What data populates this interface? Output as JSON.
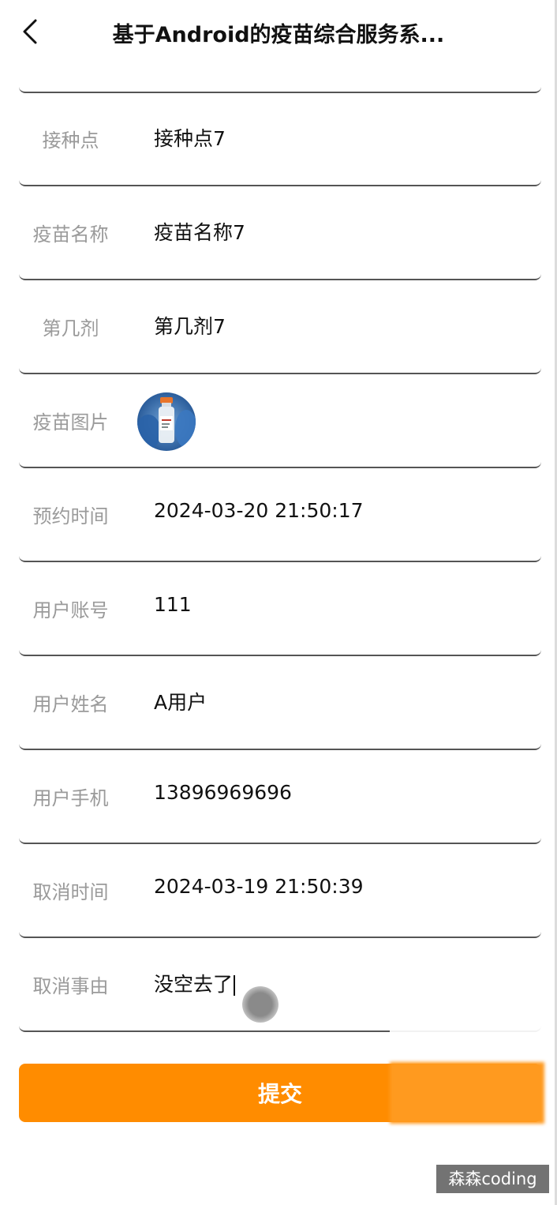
{
  "header": {
    "title": "基于Android的疫苗综合服务系...",
    "back_icon": "chevron-left-icon"
  },
  "form": {
    "rows": [
      {
        "label": "接种点",
        "value": "接种点7"
      },
      {
        "label": "疫苗名称",
        "value": "疫苗名称7"
      },
      {
        "label": "第几剂",
        "value": "第几剂7"
      },
      {
        "label": "疫苗图片",
        "value": ""
      },
      {
        "label": "预约时间",
        "value": "2024-03-20 21:50:17"
      },
      {
        "label": "用户账号",
        "value": "111"
      },
      {
        "label": "用户姓名",
        "value": "A用户"
      },
      {
        "label": "用户手机",
        "value": "13896969696"
      },
      {
        "label": "取消时间",
        "value": "2024-03-19 21:50:39"
      },
      {
        "label": "取消事由",
        "value": "没空去了"
      }
    ]
  },
  "submit_label": "提交",
  "watermark": "森森coding",
  "colors": {
    "accent": "#ff8c00",
    "label": "#9a9a9a",
    "text": "#111111"
  }
}
